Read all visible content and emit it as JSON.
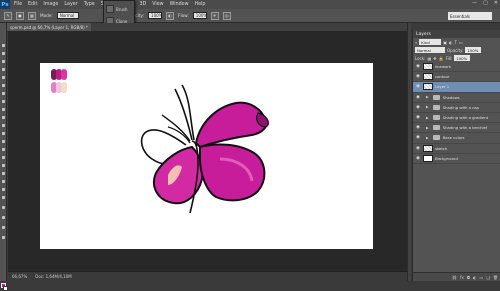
{
  "app": {
    "logo": "Ps"
  },
  "menu": [
    "File",
    "Edit",
    "Image",
    "Layer",
    "Type",
    "Select",
    "Filter",
    "3D",
    "View",
    "Window",
    "Help"
  ],
  "window_controls": [
    "—",
    "▢",
    "✕"
  ],
  "options": {
    "mode_label": "Mode:",
    "mode_value": "Normal",
    "opacity_label": "Opacity:",
    "opacity_value": "100%",
    "flow_label": "Flow:",
    "flow_value": "100%",
    "workspace": "Essentials"
  },
  "brush_popup": {
    "items": [
      "Brush",
      "Clone"
    ]
  },
  "document_tab": "sperm.psd @ 66,7% (Layer 1, RGB/8) *",
  "status": {
    "zoom": "66,67%",
    "doc": "Doc: 1,64M/4,10M"
  },
  "colors": {
    "foreground": "#c4238f",
    "background": "#ffffff",
    "accent": "#6e8fb3"
  },
  "swatches": [
    "#7a1a5e",
    "#b5207e",
    "#d933a5",
    "#e87fc6",
    "#f3c3e3",
    "#f2dcc3"
  ],
  "layers_panel": {
    "title": "Layers",
    "kind_label": "Kind",
    "blend_mode": "Normal",
    "opacity_label": "Opacity:",
    "opacity_value": "100%",
    "lock_label": "Lock:",
    "fill_label": "Fill:",
    "fill_value": "100%",
    "layers": [
      {
        "name": "linework",
        "type": "pixel",
        "selected": false
      },
      {
        "name": "contour",
        "type": "pixel",
        "selected": false
      },
      {
        "name": "Layer 1",
        "type": "pixel",
        "selected": true
      },
      {
        "name": "Shadows",
        "type": "group",
        "selected": false
      },
      {
        "name": "Shading with a cap",
        "type": "group",
        "selected": false
      },
      {
        "name": "Shading with a gradient",
        "type": "group",
        "selected": false
      },
      {
        "name": "Shading with a kerchief",
        "type": "group",
        "selected": false
      },
      {
        "name": "Base colors",
        "type": "group",
        "selected": false
      },
      {
        "name": "sketch",
        "type": "pixel",
        "selected": false
      },
      {
        "name": "Background",
        "type": "background",
        "selected": false
      }
    ],
    "footer_icons": [
      "link-icon",
      "fx-icon",
      "mask-icon",
      "adjustment-icon",
      "folder-icon",
      "new-layer-icon",
      "trash-icon"
    ]
  }
}
